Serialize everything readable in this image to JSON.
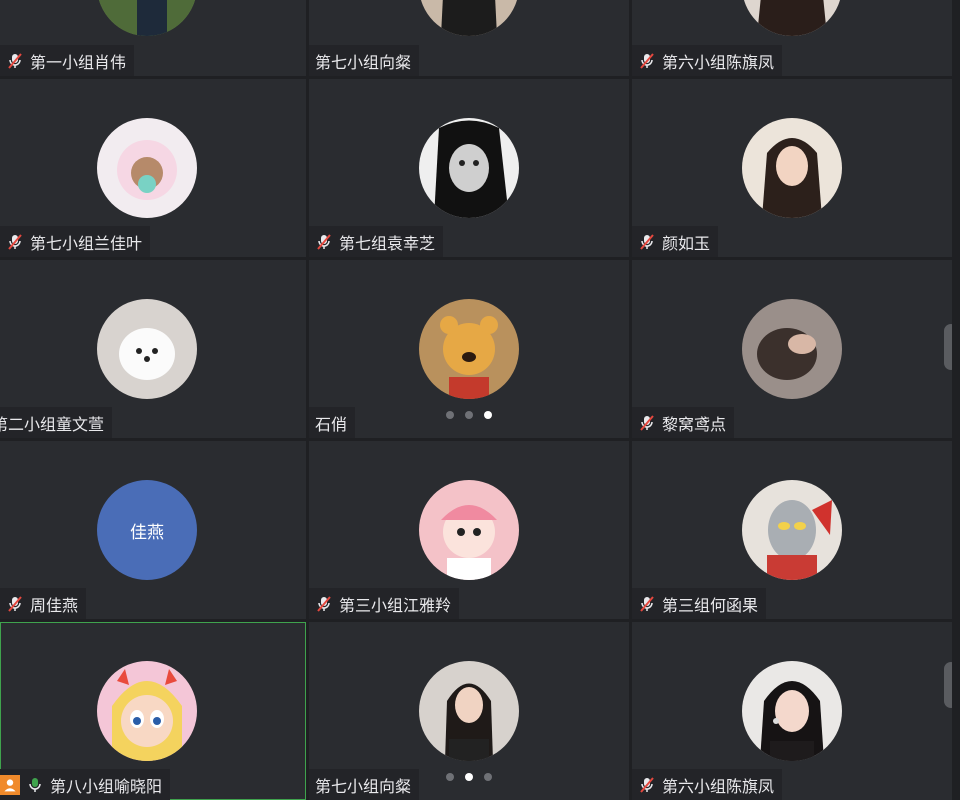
{
  "tiles": [
    {
      "name": "第一小组肖伟",
      "muted": true
    },
    {
      "name": "第七小组向粲",
      "muted": false
    },
    {
      "name": "第六小组陈旗凤",
      "muted": true
    },
    {
      "name": "第七小组兰佳叶",
      "muted": true
    },
    {
      "name": "第七组袁幸芝",
      "muted": true
    },
    {
      "name": "颜如玉",
      "muted": true
    },
    {
      "name": "第二小组童文萱",
      "muted": false
    },
    {
      "name": "石俏",
      "muted": false
    },
    {
      "name": "黎窝鸢点",
      "muted": true
    },
    {
      "name": "周佳燕",
      "muted": true,
      "avatar_text": "佳燕"
    },
    {
      "name": "第三小组江雅羚",
      "muted": true
    },
    {
      "name": "第三组何函果",
      "muted": true
    },
    {
      "name": "第八小组喻晓阳",
      "muted": false,
      "speaking": true
    },
    {
      "name": "第七小组向粲",
      "muted": false
    },
    {
      "name": "第六小组陈旗凤",
      "muted": true
    }
  ],
  "pagination_mid": {
    "total": 3,
    "active": 3
  },
  "pagination_bottom": {
    "total": 3,
    "active": 2
  },
  "colors": {
    "accent_green": "#3fa34d",
    "avatar_blue": "#4a6db7",
    "share_orange": "#f08a2b"
  }
}
